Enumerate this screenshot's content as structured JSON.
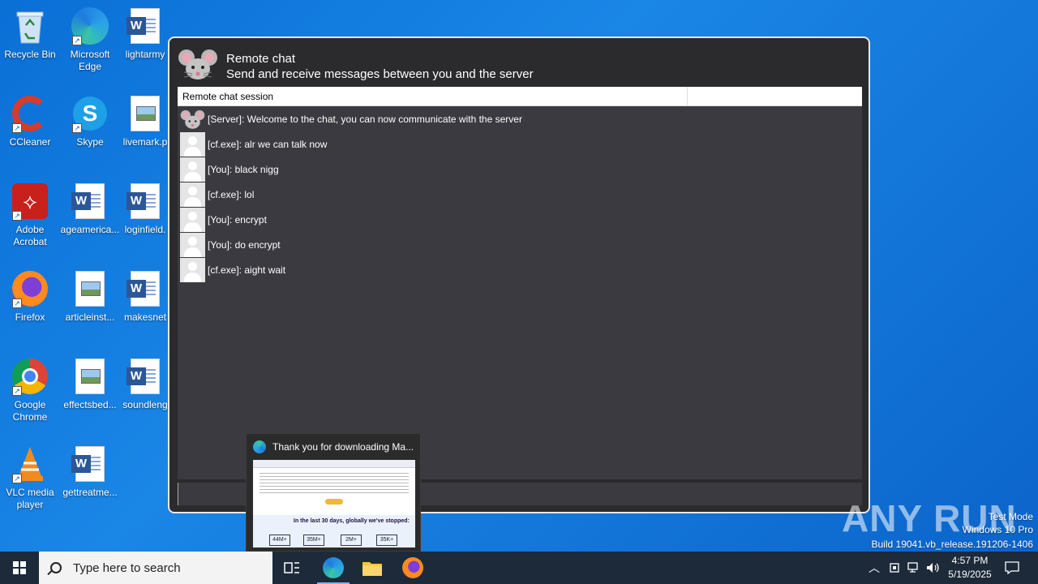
{
  "desktop": {
    "icons": [
      {
        "label": "Recycle Bin"
      },
      {
        "label": "Microsoft Edge"
      },
      {
        "label": "lightarmy"
      },
      {
        "label": "CCleaner"
      },
      {
        "label": "Skype"
      },
      {
        "label": "livemark.p"
      },
      {
        "label": "Adobe Acrobat"
      },
      {
        "label": "ageamerica..."
      },
      {
        "label": "loginfield."
      },
      {
        "label": "Firefox"
      },
      {
        "label": "articleinst..."
      },
      {
        "label": "makesnet"
      },
      {
        "label": "Google Chrome"
      },
      {
        "label": "effectsbed..."
      },
      {
        "label": "soundleng"
      },
      {
        "label": "VLC media player"
      },
      {
        "label": "gettreatme..."
      }
    ]
  },
  "chat_window": {
    "title": "Remote chat",
    "subtitle": "Send and receive messages between you and the server",
    "column_header": "Remote chat session",
    "messages": [
      {
        "text": "[Server]: Welcome to the chat, you can now communicate with the server",
        "avatar": "mouse-icon"
      },
      {
        "text": "[cf.exe]: alr we can talk now",
        "avatar": "user-icon"
      },
      {
        "text": "[You]: black nigg",
        "avatar": "user-icon"
      },
      {
        "text": "[cf.exe]: lol",
        "avatar": "user-icon"
      },
      {
        "text": "[You]: encrypt",
        "avatar": "user-icon"
      },
      {
        "text": "[You]: do encrypt",
        "avatar": "user-icon"
      },
      {
        "text": "[cf.exe]: aight wait",
        "avatar": "user-icon"
      }
    ],
    "input_value": ""
  },
  "taskbar_preview": {
    "title": "Thank you for downloading Ma...",
    "thumb_heading": "In the last 30 days, globally we've stopped:",
    "stats": [
      "44M+",
      "35M+",
      "2M+",
      "35K+"
    ]
  },
  "watermark": {
    "brand": "ANY RUN",
    "lines": [
      "Test Mode",
      "Windows 10 Pro",
      "Build 19041.vb_release.191206-1406"
    ]
  },
  "taskbar": {
    "search_placeholder": "Type here to search",
    "time": "4:57 PM",
    "date": "5/19/2025",
    "accent": "#7db4f0"
  }
}
